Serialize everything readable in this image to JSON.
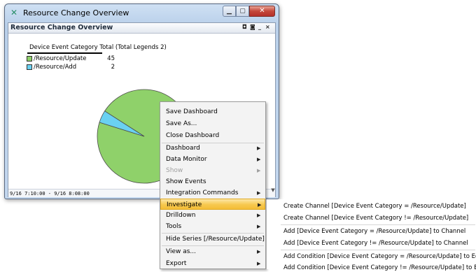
{
  "window": {
    "title": "Resource Change Overview",
    "app_icon": "arcsight-icon",
    "controls": {
      "minimize": "minimize-icon",
      "maximize": "maximize-icon",
      "close": "close-icon"
    }
  },
  "panel": {
    "title": "Resource Change Overview",
    "control_icons": [
      "restore-icon",
      "detach-icon",
      "minimize-icon",
      "close-icon"
    ]
  },
  "legend": {
    "header": "Device Event Category  Total (Total Legends 2)",
    "rows": [
      {
        "label": "/Resource/Update",
        "value": "45",
        "color": "#8fd16a"
      },
      {
        "label": "/Resource/Add",
        "value": "2",
        "color": "#6ad1f2"
      }
    ]
  },
  "status": {
    "time_range": "9/16 7:10:00 - 9/16 8:08:00"
  },
  "context_menu": {
    "items": [
      {
        "label": "Save Dashboard",
        "submenu": false,
        "disabled": false
      },
      {
        "label": "Save As...",
        "submenu": false,
        "disabled": false
      },
      {
        "label": "Close Dashboard",
        "submenu": false,
        "disabled": false
      },
      {
        "label": "Dashboard",
        "submenu": true,
        "disabled": false
      },
      {
        "label": "Data Monitor",
        "submenu": true,
        "disabled": false
      },
      {
        "label": "Show",
        "submenu": true,
        "disabled": true
      },
      {
        "label": "Show Events",
        "submenu": false,
        "disabled": false
      },
      {
        "label": "Integration Commands",
        "submenu": true,
        "disabled": false
      },
      {
        "label": "Investigate",
        "submenu": true,
        "disabled": false,
        "highlighted": true
      },
      {
        "label": "Drilldown",
        "submenu": true,
        "disabled": false
      },
      {
        "label": "Tools",
        "submenu": true,
        "disabled": false
      },
      {
        "label": "Hide Series [/Resource/Update]",
        "submenu": false,
        "disabled": false
      },
      {
        "label": "View as...",
        "submenu": true,
        "disabled": false
      },
      {
        "label": "Export",
        "submenu": true,
        "disabled": false
      }
    ]
  },
  "investigate_submenu": {
    "items": [
      "Create Channel [Device Event Category = /Resource/Update]",
      "Create Channel [Device Event Category != /Resource/Update]",
      "Add [Device Event Category = /Resource/Update] to Channel",
      "Add [Device Event Category != /Resource/Update] to Channel",
      "Add Condition [Device Event Category = /Resource/Update] to Editor",
      "Add Condition [Device Event Category != /Resource/Update] to Editor"
    ]
  },
  "chart_data": {
    "type": "pie",
    "title": "",
    "categories": [
      "/Resource/Update",
      "/Resource/Add"
    ],
    "values": [
      45,
      2
    ],
    "colors": [
      "#8fd16a",
      "#6ad1f2"
    ]
  }
}
